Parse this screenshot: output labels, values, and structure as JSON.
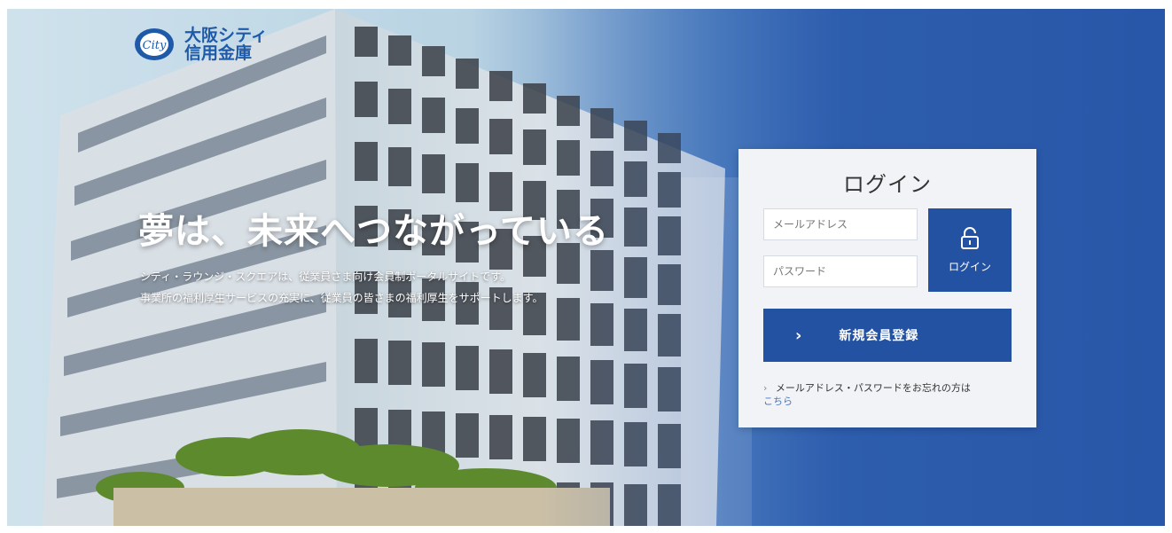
{
  "brand": {
    "name_line1": "大阪シティ",
    "name_line2": "信用金庫",
    "mark_text": "City"
  },
  "hero": {
    "headline": "夢は、未来へつながっている",
    "subtext_line1": "シティ・ラウンジ・スクエアは、従業員さま向け会員制ポータルサイトです。",
    "subtext_line2": "事業所の福利厚生サービスの充実に、従業員の皆さまの福利厚生をサポートします。"
  },
  "login": {
    "title": "ログイン",
    "email_placeholder": "メールアドレス",
    "password_placeholder": "パスワード",
    "button_label": "ログイン",
    "register_label": "新規会員登録",
    "register_chevron": "›",
    "forgot_text": "メールアドレス・パスワードをお忘れの方は",
    "forgot_link": "こちら",
    "forgot_chevron": "›"
  },
  "colors": {
    "accent": "#2452a2",
    "logo": "#1f5aa8"
  }
}
